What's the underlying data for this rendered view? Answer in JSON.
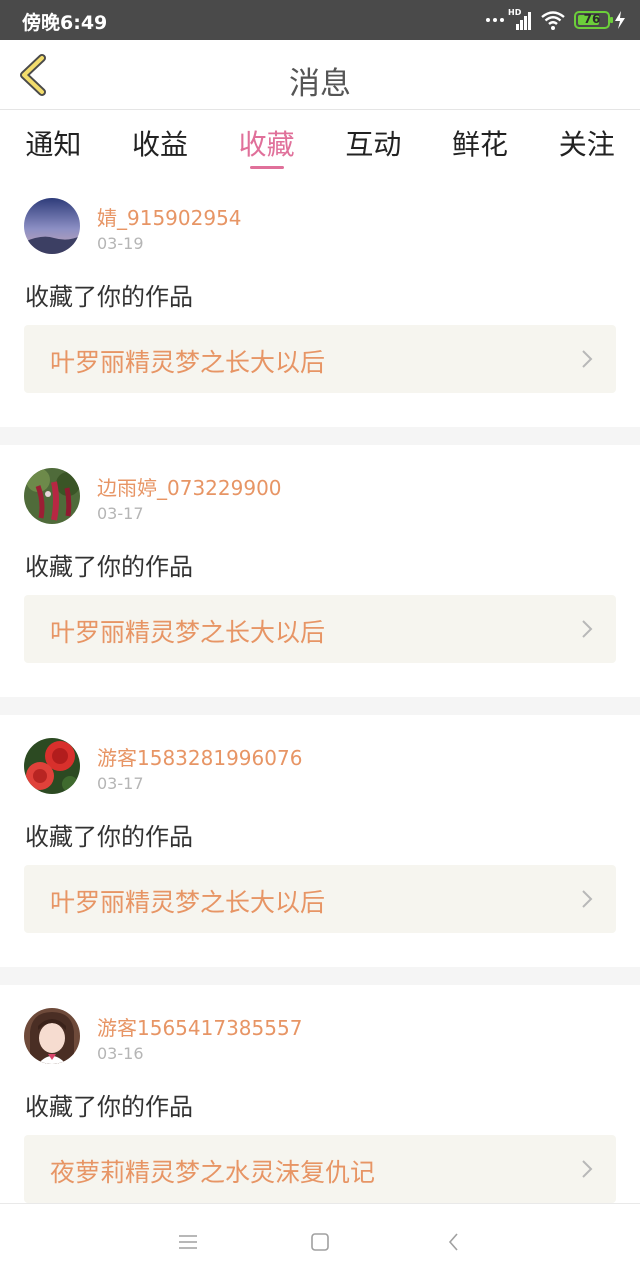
{
  "status_bar": {
    "time": "傍晚6:49",
    "network_label": "HD",
    "battery": "76",
    "battery_level": 0.76
  },
  "header": {
    "title": "消息",
    "back_icon": "chevron-left-icon"
  },
  "tabs": [
    {
      "label": "通知",
      "active": false
    },
    {
      "label": "收益",
      "active": false
    },
    {
      "label": "收藏",
      "active": true
    },
    {
      "label": "互动",
      "active": false
    },
    {
      "label": "鲜花",
      "active": false
    },
    {
      "label": "关注",
      "active": false
    }
  ],
  "messages": [
    {
      "username": "婧_915902954",
      "date": "03-19",
      "action": "收藏了你的作品",
      "work_title": "叶罗丽精灵梦之长大以后"
    },
    {
      "username": "边雨婷_073229900",
      "date": "03-17",
      "action": "收藏了你的作品",
      "work_title": "叶罗丽精灵梦之长大以后"
    },
    {
      "username": "游客1583281996076",
      "date": "03-17",
      "action": "收藏了你的作品",
      "work_title": "叶罗丽精灵梦之长大以后"
    },
    {
      "username": "游客1565417385557",
      "date": "03-16",
      "action": "收藏了你的作品",
      "work_title": "夜萝莉精灵梦之水灵沫复仇记"
    }
  ],
  "colors": {
    "accent": "#e0709a",
    "link": "#e79565",
    "back_icon": "#f2dc6c"
  },
  "nav": {
    "icons": [
      "menu-icon",
      "home-square-icon",
      "back-triangle-icon"
    ]
  }
}
